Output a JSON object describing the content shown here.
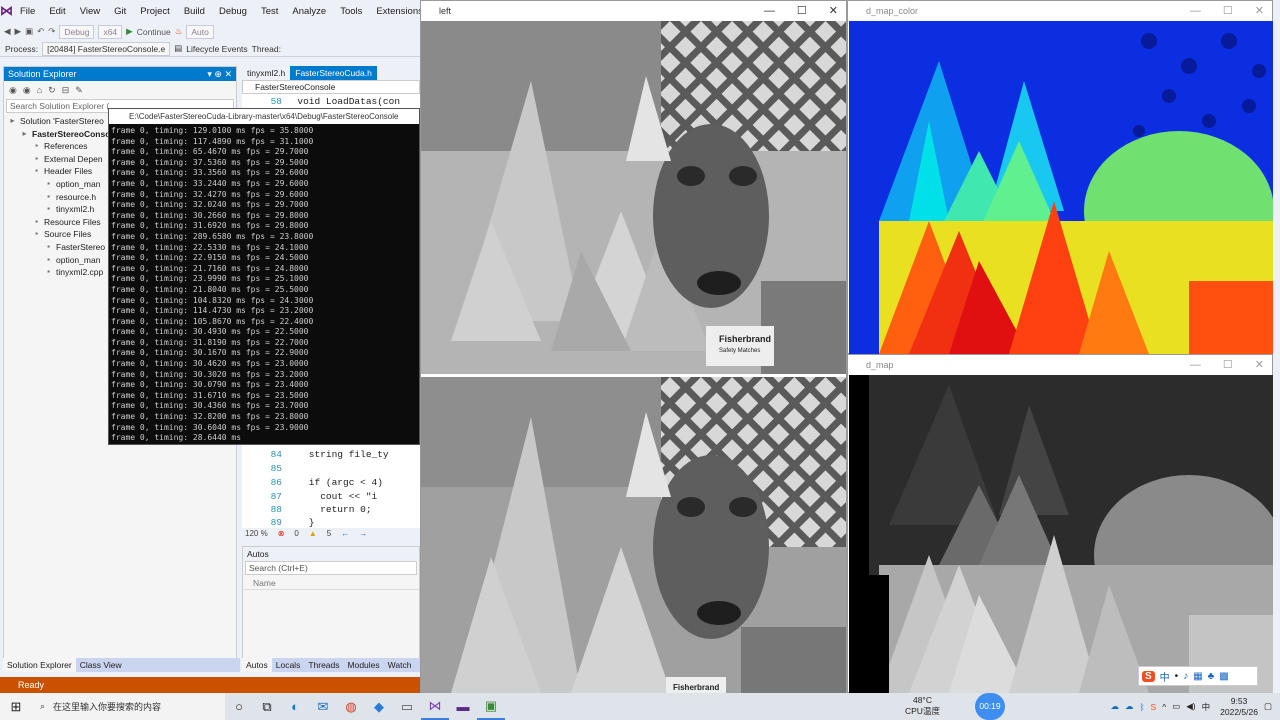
{
  "vs": {
    "menu": [
      "File",
      "Edit",
      "View",
      "Git",
      "Project",
      "Build",
      "Debug",
      "Test",
      "Analyze",
      "Tools",
      "Extensions",
      "W"
    ],
    "toolbar": {
      "config": "Debug",
      "platform": "x64",
      "continue": "Continue",
      "auto": "Auto"
    },
    "process_label": "Process:",
    "process": "[20484] FasterStereoConsole.e",
    "lifecycle": "Lifecycle Events",
    "thread": "Thread:",
    "status": "Ready"
  },
  "solution_explorer": {
    "title": "Solution Explorer",
    "search_placeholder": "Search Solution Explorer (",
    "items": [
      {
        "label": "Solution 'FasterStereo",
        "indent": 0
      },
      {
        "label": "FasterStereoConsole",
        "indent": 1,
        "bold": true
      },
      {
        "label": "References",
        "indent": 2
      },
      {
        "label": "External Depen",
        "indent": 2
      },
      {
        "label": "Header Files",
        "indent": 2
      },
      {
        "label": "option_man",
        "indent": 3
      },
      {
        "label": "resource.h",
        "indent": 3
      },
      {
        "label": "tinyxml2.h",
        "indent": 3
      },
      {
        "label": "Resource Files",
        "indent": 2
      },
      {
        "label": "Source Files",
        "indent": 2
      },
      {
        "label": "FasterStereo",
        "indent": 3
      },
      {
        "label": "option_man",
        "indent": 3
      },
      {
        "label": "tinyxml2.cpp",
        "indent": 3
      }
    ],
    "tabs": [
      "Solution Explorer",
      "Class View"
    ]
  },
  "editor": {
    "tabs": [
      "tinyxml2.h",
      "FasterStereoCuda.h"
    ],
    "scope": "FasterStereoConsole",
    "lines": [
      {
        "n": "58",
        "code": "  void LoadDatas(con"
      },
      {
        "n": "84",
        "code": "    string file_ty"
      },
      {
        "n": "85",
        "code": ""
      },
      {
        "n": "86",
        "code": "    if (argc < 4)"
      },
      {
        "n": "87",
        "code": "      cout << \"i"
      },
      {
        "n": "88",
        "code": "      return 0;"
      },
      {
        "n": "89",
        "code": "    }"
      }
    ],
    "zoom": "120 %",
    "errors": "0",
    "warnings": "5"
  },
  "autos": {
    "title": "Autos",
    "search": "Search (Ctrl+E)",
    "column": "Name",
    "tabs": [
      "Autos",
      "Locals",
      "Threads",
      "Modules",
      "Watch"
    ]
  },
  "console": {
    "title": "E:\\Code\\FasterStereoCuda-Library-master\\x64\\Debug\\FasterStereoConsole",
    "lines": [
      "frame 0, timing: 129.0100 ms fps = 35.8000",
      "frame 0, timing: 117.4890 ms fps = 31.1000",
      "frame 0, timing: 65.4670 ms fps = 29.7000",
      "frame 0, timing: 37.5360 ms fps = 29.5000",
      "frame 0, timing: 33.3560 ms fps = 29.6000",
      "frame 0, timing: 33.2440 ms fps = 29.6000",
      "frame 0, timing: 32.4270 ms fps = 29.6000",
      "frame 0, timing: 32.0240 ms fps = 29.7000",
      "frame 0, timing: 30.2660 ms fps = 29.8000",
      "frame 0, timing: 31.6920 ms fps = 29.8000",
      "frame 0, timing: 289.6580 ms fps = 23.8000",
      "frame 0, timing: 22.5330 ms fps = 24.1000",
      "frame 0, timing: 22.9150 ms fps = 24.5000",
      "frame 0, timing: 21.7160 ms fps = 24.8000",
      "frame 0, timing: 23.9990 ms fps = 25.1000",
      "frame 0, timing: 21.8040 ms fps = 25.5000",
      "frame 0, timing: 104.8320 ms fps = 24.3000",
      "frame 0, timing: 114.4730 ms fps = 23.2000",
      "frame 0, timing: 105.8670 ms fps = 22.4000",
      "frame 0, timing: 30.4930 ms fps = 22.5000",
      "frame 0, timing: 31.8190 ms fps = 22.7000",
      "frame 0, timing: 30.1670 ms fps = 22.9000",
      "frame 0, timing: 30.4620 ms fps = 23.0000",
      "frame 0, timing: 30.3020 ms fps = 23.2000",
      "frame 0, timing: 30.0790 ms fps = 23.4000",
      "frame 0, timing: 31.6710 ms fps = 23.5000",
      "frame 0, timing: 30.4360 ms fps = 23.7000",
      "frame 0, timing: 32.8200 ms fps = 23.8000",
      "frame 0, timing: 30.6040 ms fps = 23.9000",
      "frame 0, timing: 28.6440 ms"
    ]
  },
  "windows": {
    "left": "left",
    "color": "d_map_color",
    "gray": "d_map",
    "label_brand": "Fisherbrand",
    "label_line": "Safety Matches",
    "label_brand2": "Fisherbrand"
  },
  "taskbar": {
    "search": "在这里输入你要搜索的内容",
    "temp": "48°C",
    "temp_label": "CPU温度",
    "timer": "00:19",
    "time": "9:53",
    "date": "2022/5/26"
  },
  "ime": {
    "lang": "中"
  }
}
